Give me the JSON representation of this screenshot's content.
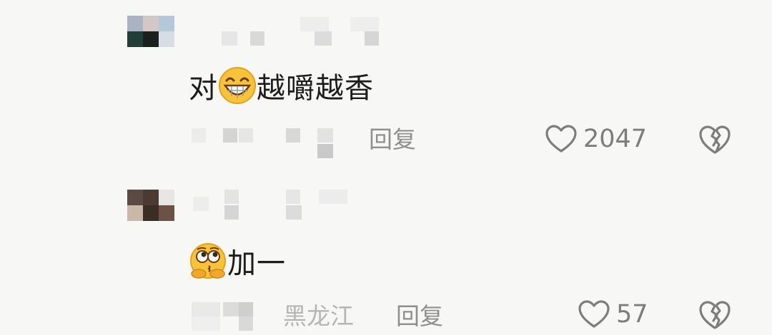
{
  "comments": [
    {
      "text": "对",
      "text_after": "越嚼越香",
      "emoji": "grin-icon",
      "reply_label": "回复",
      "location": "",
      "likes": "2047"
    },
    {
      "text": "",
      "text_after": "加一",
      "emoji": "hmm-icon",
      "reply_label": "回复",
      "location": "黑龙江",
      "likes": "57"
    }
  ],
  "colors": {
    "background": "#f7f7f5",
    "text": "#1c1c1c",
    "meta": "#8f8f8f",
    "emoji_yellow": "#f7c33a"
  }
}
